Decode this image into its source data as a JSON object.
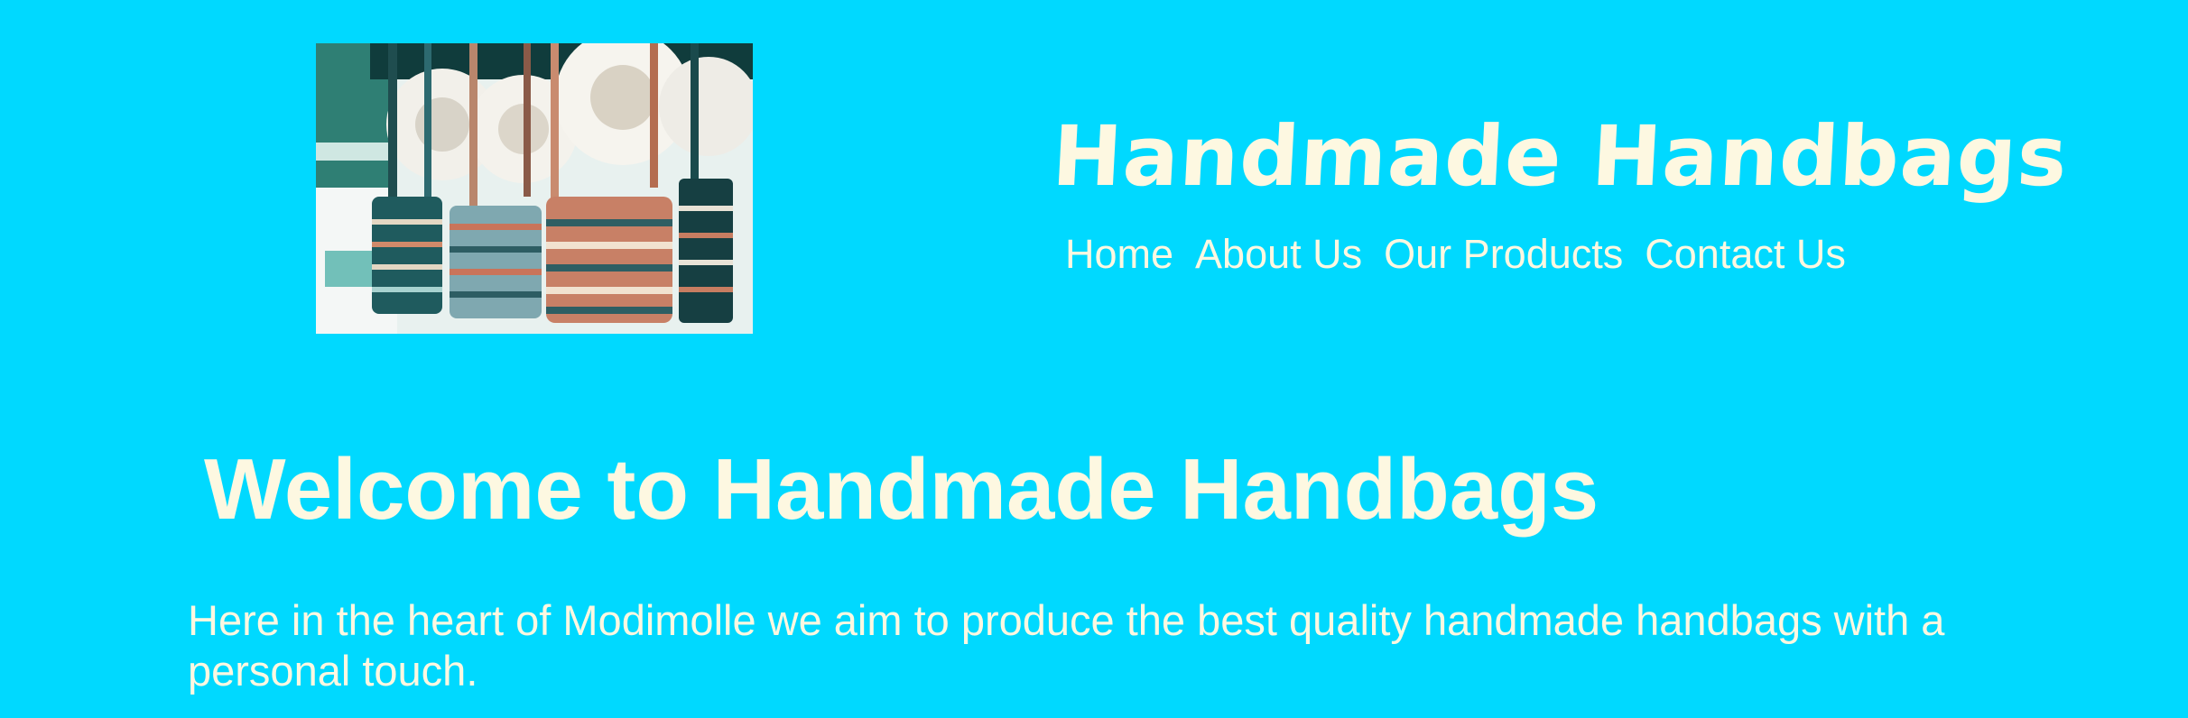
{
  "colors": {
    "background": "#00d9ff",
    "text": "#fdf8e1"
  },
  "header": {
    "image_alt": "Handwoven bags hanging at a market stall",
    "title": "Handmade  Handbags",
    "nav": [
      {
        "label": "Home"
      },
      {
        "label": "About Us"
      },
      {
        "label": "Our Products"
      },
      {
        "label": "Contact Us"
      }
    ]
  },
  "main": {
    "heading": "Welcome to Handmade Handbags",
    "intro": "Here in the heart of Modimolle we aim to produce the best quality handmade handbags with a personal touch."
  }
}
